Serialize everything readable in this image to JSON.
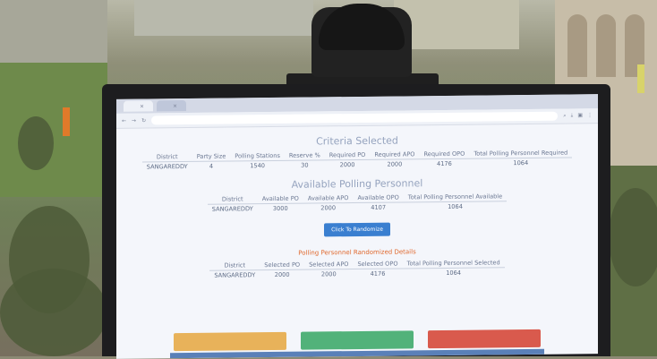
{
  "browser": {
    "tabs": [
      "",
      ""
    ],
    "address": ""
  },
  "criteria": {
    "heading": "Criteria Selected",
    "columns": [
      "District",
      "Party Size",
      "Polling Stations",
      "Reserve %",
      "Required PO",
      "Required APO",
      "Required OPO",
      "Total Polling Personnel Required"
    ],
    "row": [
      "SANGAREDDY",
      "4",
      "1540",
      "30",
      "2000",
      "2000",
      "4176",
      "1064"
    ]
  },
  "available": {
    "heading": "Available Polling Personnel",
    "columns": [
      "District",
      "Available PO",
      "Available APO",
      "Available OPO",
      "Total Polling Personnel Available"
    ],
    "row": [
      "SANGAREDDY",
      "3000",
      "2000",
      "4107",
      "1064"
    ]
  },
  "randomize_button": "Click To Randomize",
  "randomized": {
    "warning": "Polling Personnel Randomized Details",
    "columns": [
      "District",
      "Selected PO",
      "Selected APO",
      "Selected OPO",
      "Total Polling Personnel Selected"
    ],
    "row": [
      "SANGAREDDY",
      "2000",
      "2000",
      "4176",
      "1064"
    ]
  },
  "footer": {
    "buttons": [
      "",
      "",
      ""
    ]
  },
  "colors": {
    "button_blue": "#3a7fd0",
    "button_yellow": "#e8b25a",
    "button_green": "#52b27a",
    "button_red": "#d95a4d",
    "warning": "#e0692e"
  }
}
